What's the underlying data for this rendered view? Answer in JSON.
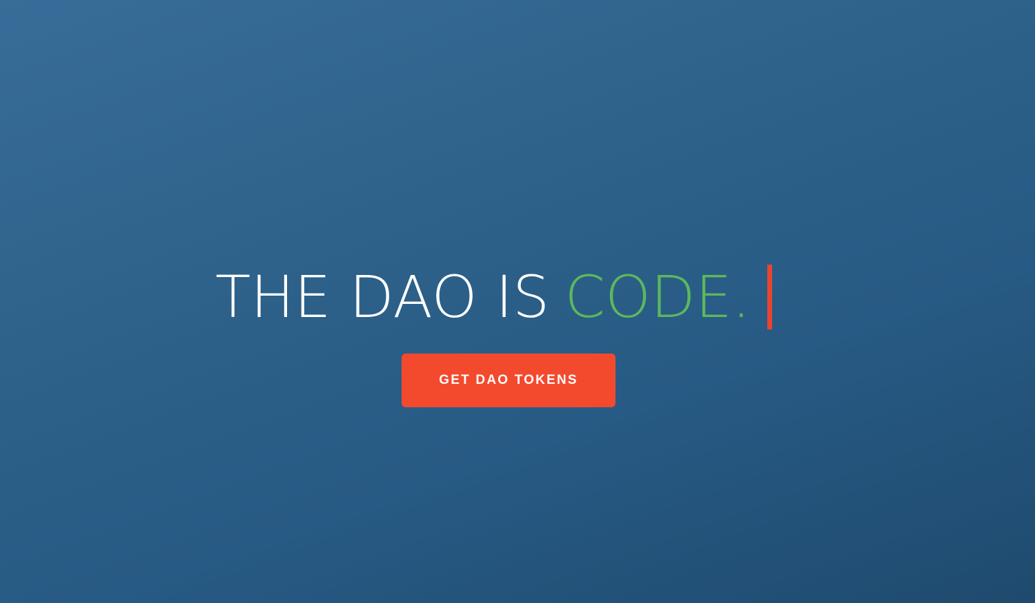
{
  "hero": {
    "headline_lead": "THE DAO IS",
    "headline_accent": "CODE.",
    "cta_label": "GET DAO TOKENS"
  },
  "colors": {
    "background_top": "#386d99",
    "background_bottom": "#1f4a6e",
    "headline_text": "#ffffff",
    "accent_text": "#5cb85c",
    "cursor": "#e8442f",
    "cta_background": "#f34a2e",
    "cta_text": "#ffffff"
  }
}
